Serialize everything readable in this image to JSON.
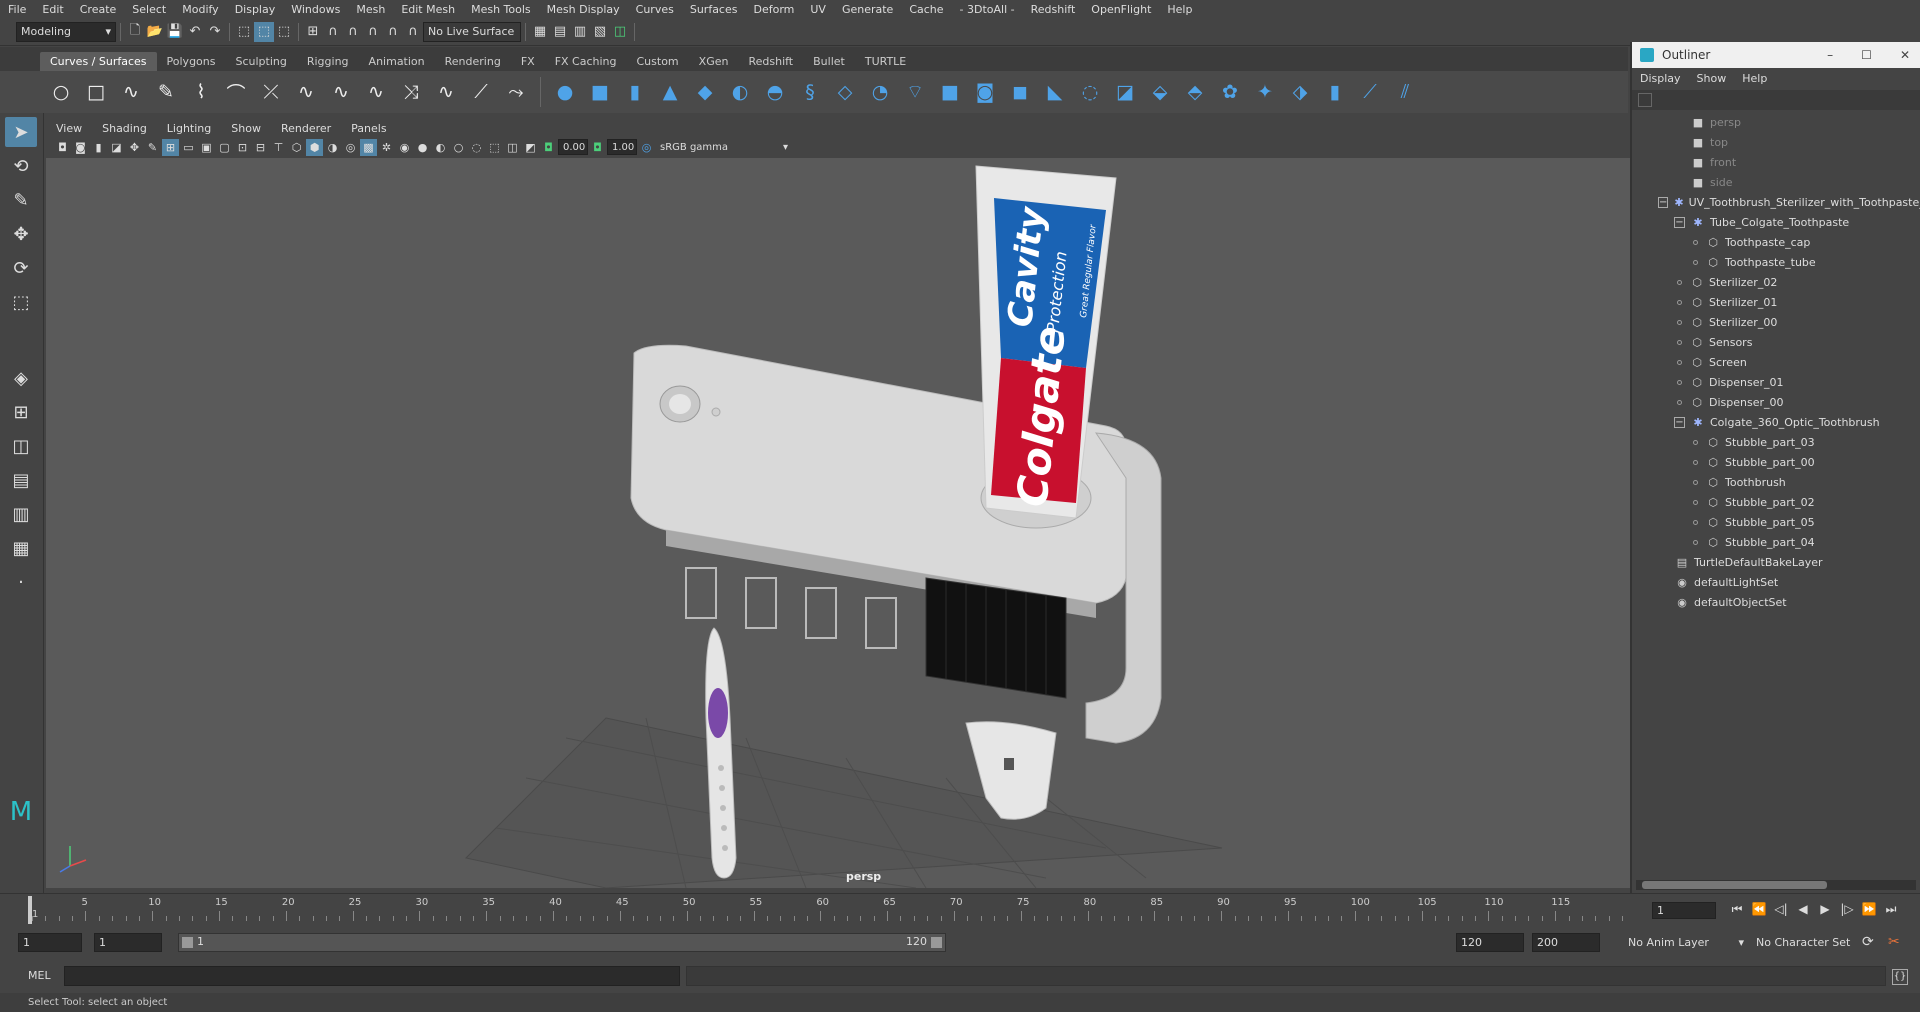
{
  "menubar": [
    "File",
    "Edit",
    "Create",
    "Select",
    "Modify",
    "Display",
    "Windows",
    "Mesh",
    "Edit Mesh",
    "Mesh Tools",
    "Mesh Display",
    "Curves",
    "Surfaces",
    "Deform",
    "UV",
    "Generate",
    "Cache",
    "- 3DtoAll -",
    "Redshift",
    "OpenFlight",
    "Help"
  ],
  "statusline": {
    "mode": "Modeling",
    "live_surface": "No Live Surface"
  },
  "shelf_tabs": [
    "Curves / Surfaces",
    "Polygons",
    "Sculpting",
    "Rigging",
    "Animation",
    "Rendering",
    "FX",
    "FX Caching",
    "Custom",
    "XGen",
    "Redshift",
    "Bullet",
    "TURTLE"
  ],
  "panel_menu": [
    "View",
    "Shading",
    "Lighting",
    "Show",
    "Renderer",
    "Panels"
  ],
  "panel_toolbar": {
    "exposure": "0.00",
    "gamma": "1.00",
    "color_space": "sRGB gamma"
  },
  "viewport": {
    "camera": "persp"
  },
  "outliner": {
    "title": "Outliner",
    "menu": [
      "Display",
      "Show",
      "Help"
    ],
    "nodes": [
      {
        "label": "persp",
        "level": 1,
        "icon": "camera",
        "dim": true
      },
      {
        "label": "top",
        "level": 1,
        "icon": "camera",
        "dim": true
      },
      {
        "label": "front",
        "level": 1,
        "icon": "camera",
        "dim": true
      },
      {
        "label": "side",
        "level": 1,
        "icon": "camera",
        "dim": true
      },
      {
        "label": "UV_Toothbrush_Sterilizer_with_Toothpaste_",
        "level": 0,
        "icon": "group",
        "expand": "minus"
      },
      {
        "label": "Tube_Colgate_Toothpaste",
        "level": 1,
        "icon": "group",
        "expand": "minus"
      },
      {
        "label": "Toothpaste_cap",
        "level": 2,
        "icon": "mesh"
      },
      {
        "label": "Toothpaste_tube",
        "level": 2,
        "icon": "mesh"
      },
      {
        "label": "Sterilizer_02",
        "level": 1,
        "icon": "mesh"
      },
      {
        "label": "Sterilizer_01",
        "level": 1,
        "icon": "mesh"
      },
      {
        "label": "Sterilizer_00",
        "level": 1,
        "icon": "mesh"
      },
      {
        "label": "Sensors",
        "level": 1,
        "icon": "mesh"
      },
      {
        "label": "Screen",
        "level": 1,
        "icon": "mesh"
      },
      {
        "label": "Dispenser_01",
        "level": 1,
        "icon": "mesh"
      },
      {
        "label": "Dispenser_00",
        "level": 1,
        "icon": "mesh"
      },
      {
        "label": "Colgate_360_Optic_Toothbrush",
        "level": 1,
        "icon": "group",
        "expand": "minus"
      },
      {
        "label": "Stubble_part_03",
        "level": 2,
        "icon": "mesh"
      },
      {
        "label": "Stubble_part_00",
        "level": 2,
        "icon": "mesh"
      },
      {
        "label": "Toothbrush",
        "level": 2,
        "icon": "mesh"
      },
      {
        "label": "Stubble_part_02",
        "level": 2,
        "icon": "mesh"
      },
      {
        "label": "Stubble_part_05",
        "level": 2,
        "icon": "mesh"
      },
      {
        "label": "Stubble_part_04",
        "level": 2,
        "icon": "mesh"
      },
      {
        "label": "TurtleDefaultBakeLayer",
        "level": 0,
        "icon": "layer"
      },
      {
        "label": "defaultLightSet",
        "level": 0,
        "icon": "set"
      },
      {
        "label": "defaultObjectSet",
        "level": 0,
        "icon": "set"
      }
    ]
  },
  "timeslider": {
    "ticks": [
      5,
      10,
      15,
      20,
      25,
      30,
      35,
      40,
      45,
      50,
      55,
      60,
      65,
      70,
      75,
      80,
      85,
      90,
      95,
      100,
      105,
      110,
      115
    ],
    "min_frame": 1,
    "max_frame": 120,
    "start_label": "1",
    "current_frame": "1"
  },
  "rangeslider": {
    "start": "1",
    "playback_start": "1",
    "range_start": "1",
    "range_end": "120",
    "playback_end": "120",
    "end": "200",
    "anim_layer": "No Anim Layer",
    "character_set": "No Character Set"
  },
  "cmdline": {
    "label": "MEL"
  },
  "helpline": {
    "text": "Select Tool: select an object"
  },
  "tube_print": {
    "brand": "Colgate",
    "line1": "Cavity",
    "line2": "Protection",
    "flavor": "Great Regular Flavor"
  }
}
